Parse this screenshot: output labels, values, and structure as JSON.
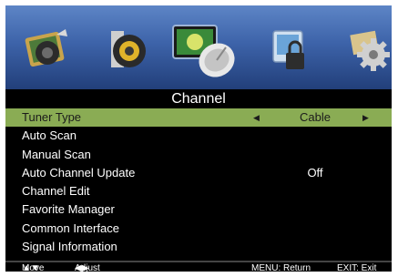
{
  "title": "Channel",
  "icons": [
    "picture-icon",
    "sound-icon",
    "channel-satellite-icon",
    "lock-icon",
    "setup-gear-icon"
  ],
  "menu": {
    "items": [
      {
        "label": "Tuner Type",
        "value": "Cable",
        "selected": true,
        "arrows": true
      },
      {
        "label": "Auto Scan",
        "value": ""
      },
      {
        "label": "Manual Scan",
        "value": ""
      },
      {
        "label": "Auto Channel Update",
        "value": "Off"
      },
      {
        "label": "Channel Edit",
        "value": ""
      },
      {
        "label": "Favorite Manager",
        "value": ""
      },
      {
        "label": "Common Interface",
        "value": ""
      },
      {
        "label": "Signal Information",
        "value": ""
      }
    ]
  },
  "footer": {
    "move_label": "Move",
    "adjust_label": "Adjust",
    "menu_label": "MENU: Return",
    "exit_label": "EXIT: Exit"
  },
  "colors": {
    "selected_row": "#8aac54",
    "icon_bar": "#3d63a9",
    "background": "#000000"
  }
}
